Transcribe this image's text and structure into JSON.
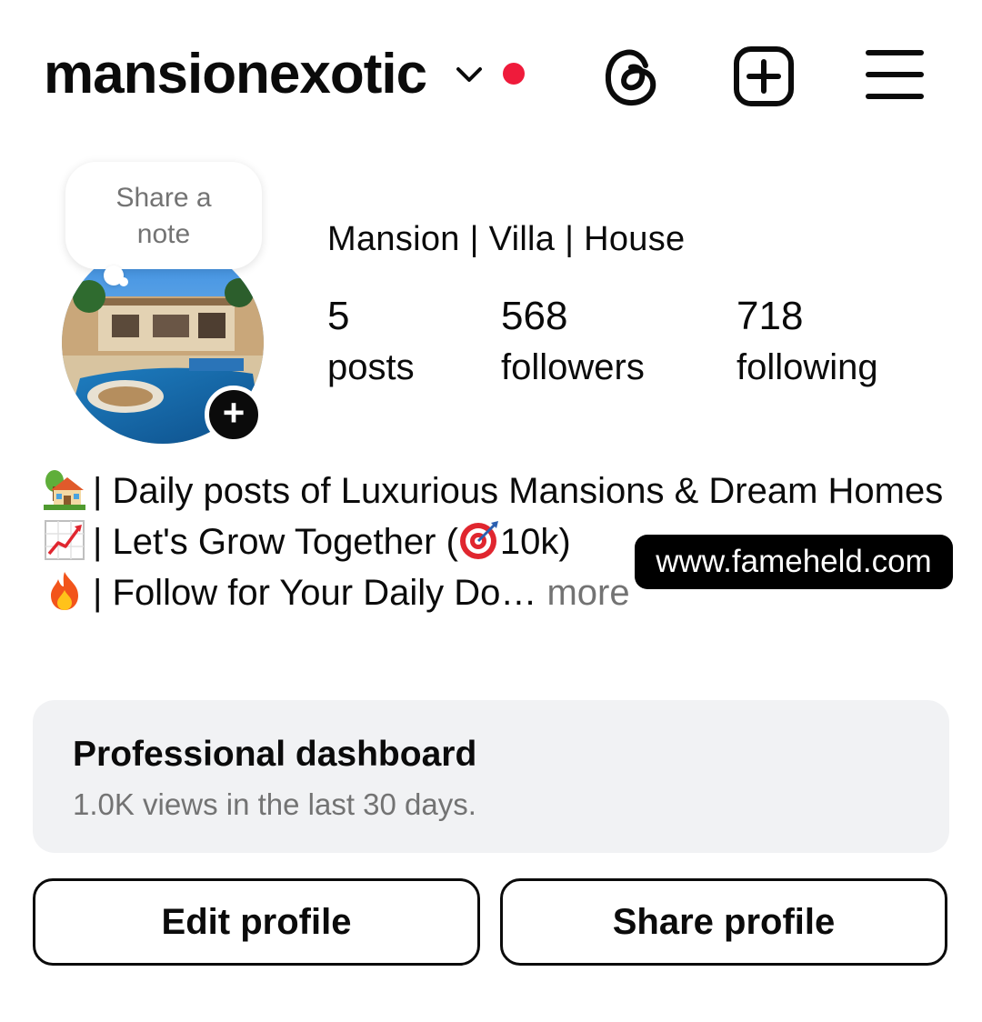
{
  "header": {
    "username": "mansionexotic",
    "icons": [
      "chevron-down-icon",
      "notification-dot",
      "threads-icon",
      "new-post-icon",
      "menu-icon"
    ],
    "notification_color": "#ef1b3b"
  },
  "note": {
    "text": "Share a note"
  },
  "profile": {
    "display_name": "Mansion | Villa | House",
    "stats": [
      {
        "value": "5",
        "label": "posts"
      },
      {
        "value": "568",
        "label": "followers"
      },
      {
        "value": "718",
        "label": "following"
      }
    ]
  },
  "bio": {
    "lines": [
      {
        "emoji": "house-with-garden-icon",
        "text": "| Daily posts of Luxurious Mansions & Dream Homes"
      },
      {
        "emoji": "chart-increasing-icon",
        "text": "| Let's Grow Together (",
        "emoji2": "target-icon",
        "text2": "10k)"
      },
      {
        "emoji": "fire-icon",
        "text": "| Follow for Your Daily Do…",
        "more": "more"
      }
    ]
  },
  "watermark": {
    "text": "www.fameheld.com"
  },
  "dashboard": {
    "title": "Professional dashboard",
    "subtitle": "1.0K views in the last 30 days."
  },
  "actions": {
    "edit_label": "Edit profile",
    "share_label": "Share profile"
  }
}
